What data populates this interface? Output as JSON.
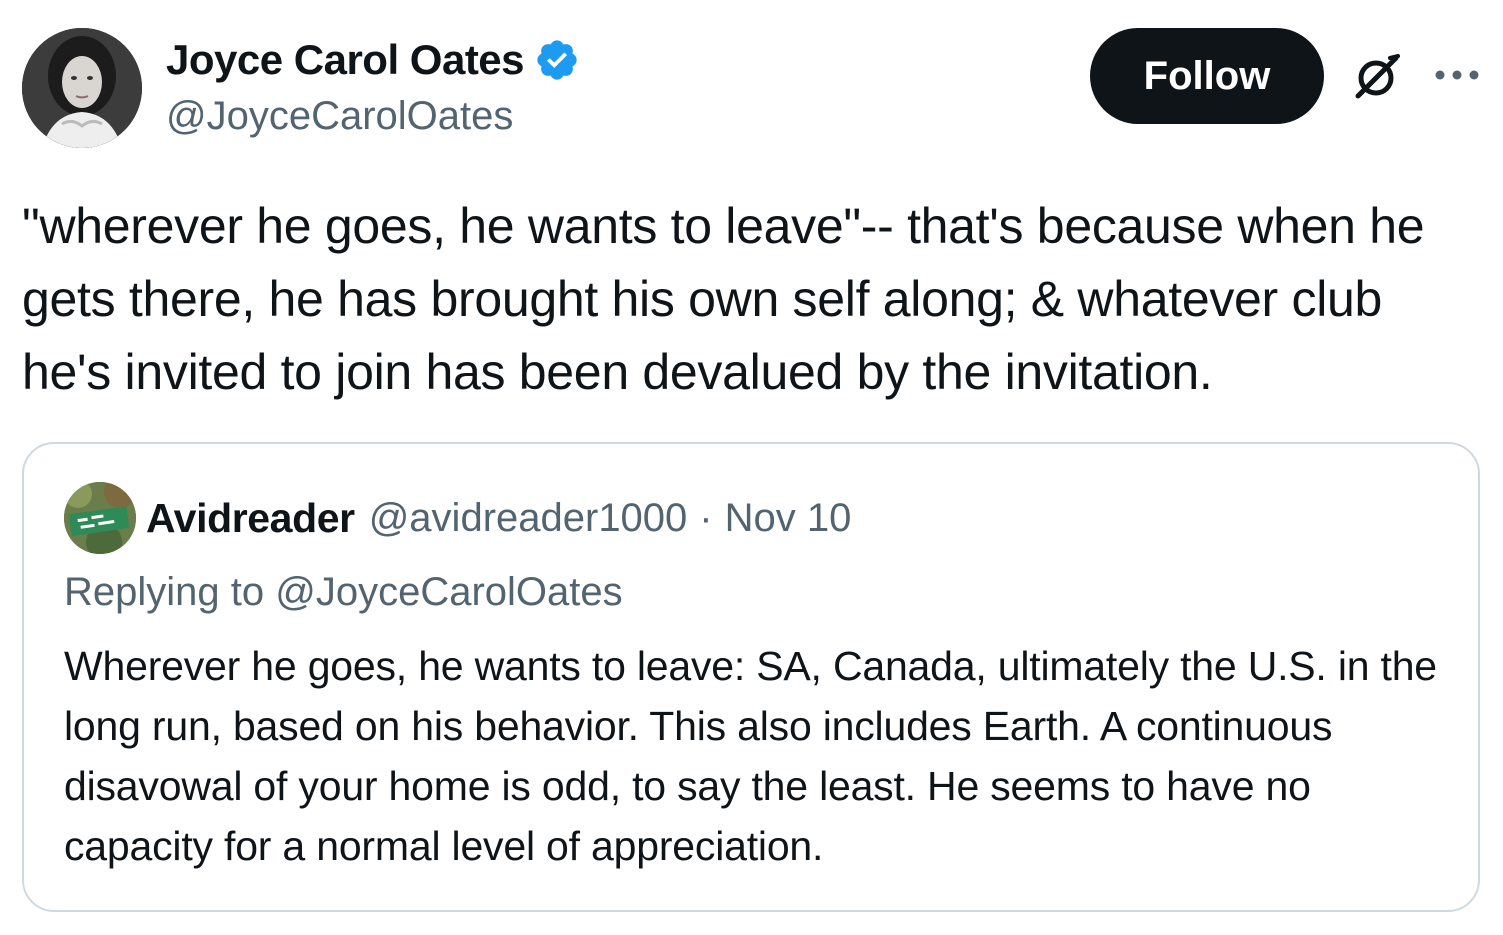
{
  "tweet": {
    "author": {
      "name": "Joyce Carol Oates",
      "handle": "@JoyceCarolOates",
      "verified": true,
      "verified_color": "#1d9bf0"
    },
    "follow_label": "Follow",
    "text": "\"wherever he goes, he wants to leave\"-- that's because when he gets there, he has brought his own self along; & whatever club he's invited to join has been devalued by the invitation.",
    "icons": {
      "grok": "grok-icon",
      "more": "more-icon"
    },
    "quoted": {
      "name": "Avidreader",
      "handle": "@avidreader1000",
      "separator": "·",
      "date": "Nov 10",
      "reply_to": "Replying to @JoyceCarolOates",
      "text": "Wherever he goes, he wants to leave: SA, Canada, ultimately the U.S. in the long run, based on his behavior. This also includes Earth. A continuous disavowal of your home is odd, to say the least. He seems to have no capacity for a normal level of appreciation."
    }
  },
  "colors": {
    "text": "#0f1419",
    "secondary": "#536471",
    "border": "#cfd9de",
    "button_bg": "#0f1419"
  }
}
